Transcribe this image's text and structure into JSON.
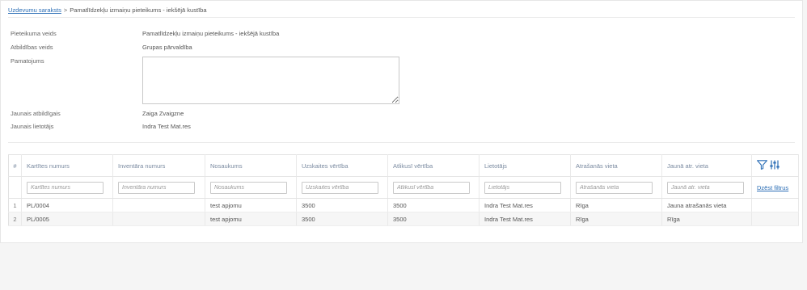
{
  "breadcrumb": {
    "root": "Uzdevumu saraksts",
    "separator": ">",
    "current": "Pamatlīdzekļu izmaiņu pieteikums - iekšējā kustība"
  },
  "form": {
    "request_type_label": "Pieteikuma veids",
    "request_type_value": "Pamatlīdzekļu izmaiņu pieteikums - iekšējā kustība",
    "responsibility_label": "Atbildības veids",
    "responsibility_value": "Grupas pārvaldība",
    "justification_label": "Pamatojums",
    "justification_value": "",
    "new_responsible_label": "Jaunais atbildīgais",
    "new_responsible_value": "Zaiga Zvaigzne",
    "new_user_label": "Jaunais lietotājs",
    "new_user_value": "Indra Test Mat.res"
  },
  "table": {
    "headers": {
      "num": "#",
      "card": "Kartītes numurs",
      "inventory": "Inventāra numurs",
      "name": "Nosaukums",
      "account": "Uzskaites vērtība",
      "residual": "Atlikusī vērtība",
      "user": "Lietotājs",
      "location": "Atrašanās vieta",
      "new_location": "Jaunā atr. vieta"
    },
    "placeholders": {
      "card": "Kartītes numurs",
      "inventory": "Inventāra numurs",
      "name": "Nosaukums",
      "account": "Uzskaites vērtība",
      "residual": "Atlikusī vērtība",
      "user": "Lietotājs",
      "location": "Atrašanās vieta",
      "new_location": "Jaunā atr. vieta"
    },
    "clear_filters": "Dzēst filtrus",
    "rows": [
      {
        "num": "1",
        "card": "PL/0004",
        "inventory": "",
        "name": "test apjomu",
        "account": "3500",
        "residual": "3500",
        "user": "Indra Test Mat.res",
        "location": "Rīga",
        "new_location": "Jauna atrašanās vieta"
      },
      {
        "num": "2",
        "card": "PL/0005",
        "inventory": "",
        "name": "test apjomu",
        "account": "3500",
        "residual": "3500",
        "user": "Indra Test Mat.res",
        "location": "Rīga",
        "new_location": "Rīga"
      }
    ]
  },
  "colors": {
    "link": "#2a6db5",
    "header_text": "#7a8aa0",
    "icon": "#2a6db5"
  },
  "icons": {
    "filter": "filter-icon",
    "columns": "column-settings-icon"
  }
}
